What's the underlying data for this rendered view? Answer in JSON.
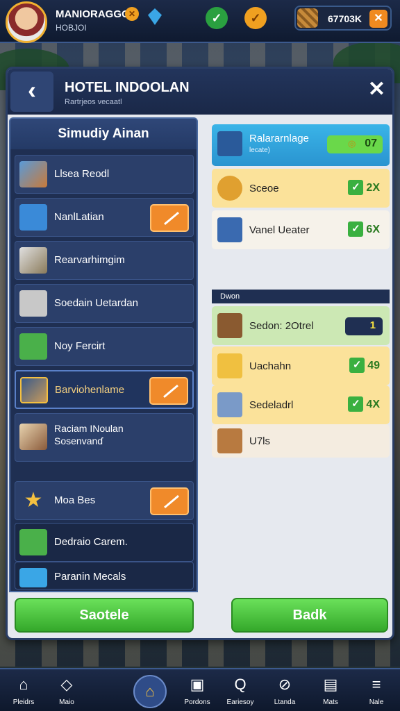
{
  "player": {
    "name": "MANIORAGGO",
    "id": "HOBJOI",
    "badge": "✕"
  },
  "top_buttons": {
    "check": "✓",
    "coin": "✓"
  },
  "currency": {
    "value": "67703K",
    "plus": "✕"
  },
  "panel": {
    "title": "HOTEL INDOOLAN",
    "subtitle": "Rartrjeos vecaatl",
    "back": "‹",
    "close": "✕"
  },
  "left_list": {
    "header": "Simudiy Ainan",
    "items": [
      {
        "label": "Llsea Reodl"
      },
      {
        "label": "NanlLatian"
      },
      {
        "label": "Rearvarhimgim"
      },
      {
        "label": "Soedain Uetardan"
      },
      {
        "label": "Noy Fercirt"
      },
      {
        "label": "Barviohenlame"
      },
      {
        "label": "Raciam INoulan",
        "label2": "Sosenvanɗ"
      },
      {
        "label": "Moa Bes"
      },
      {
        "label": "Dedraio Carem."
      },
      {
        "label": "Paranin Mecals"
      }
    ]
  },
  "right_list": {
    "items": [
      {
        "label": "Ralararnlage",
        "sub": "lecate)",
        "value": "07",
        "coin": "◎"
      },
      {
        "label": "Sceoe",
        "value": "2X"
      },
      {
        "label": "Vanel Ueater",
        "value": "6X"
      },
      {
        "label": "Sedon: 2Otrel",
        "value": "1"
      },
      {
        "label": "Uachahn",
        "value": "49"
      },
      {
        "label": "Sedeladrl",
        "value": "4X"
      },
      {
        "label": "U7ls"
      }
    ],
    "section": "Dwon",
    "check_mark": "✓"
  },
  "buttons": {
    "left": "Saotele",
    "right": "Badk"
  },
  "nav": [
    {
      "label": "Pleidrs",
      "icon": "home-icon",
      "glyph": "⌂"
    },
    {
      "label": "Maio",
      "icon": "box-icon",
      "glyph": "◇"
    },
    {
      "label": "",
      "icon": "home-gold-icon",
      "glyph": "⌂"
    },
    {
      "label": "Pordons",
      "icon": "cup-icon",
      "glyph": "▣"
    },
    {
      "label": "Eariesoy",
      "icon": "search-icon",
      "glyph": "Q"
    },
    {
      "label": "Ltanda",
      "icon": "compass-icon",
      "glyph": "⊘"
    },
    {
      "label": "Mats",
      "icon": "bag-icon",
      "glyph": "▤"
    },
    {
      "label": "Nale",
      "icon": "menu-icon",
      "glyph": "≡"
    }
  ],
  "colors": {
    "accent": "#f08a2a",
    "panel": "#1f2f52",
    "green": "#34a82a"
  }
}
